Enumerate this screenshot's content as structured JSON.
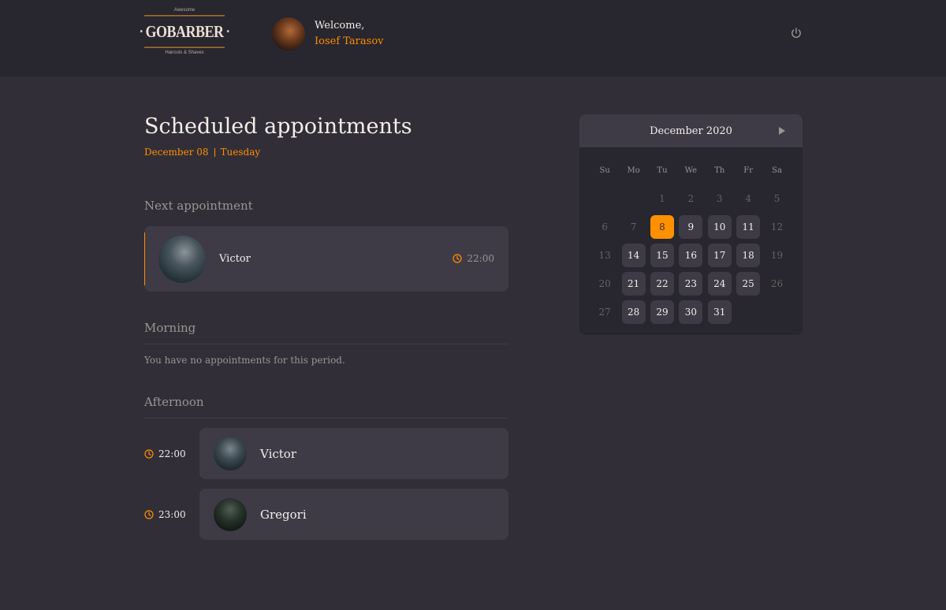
{
  "header": {
    "logo": {
      "top": "Awesome",
      "brand": "GOBARBER",
      "bottom": "Haircuts & Shaves"
    },
    "welcome": "Welcome,",
    "user_name": "Iosef Tarasov",
    "power_icon": "power-icon"
  },
  "schedule": {
    "title": "Scheduled appointments",
    "date": "December 08",
    "weekday": "Tuesday",
    "next_label": "Next appointment",
    "next": {
      "name": "Victor",
      "time": "22:00"
    },
    "morning_label": "Morning",
    "morning_empty": "You have no appointments for this period.",
    "afternoon_label": "Afternoon",
    "afternoon": [
      {
        "time": "22:00",
        "name": "Victor"
      },
      {
        "time": "23:00",
        "name": "Gregori"
      }
    ]
  },
  "calendar": {
    "month": "December 2020",
    "weekdays": [
      "Su",
      "Mo",
      "Tu",
      "We",
      "Th",
      "Fr",
      "Sa"
    ],
    "weeks": [
      [
        "",
        "",
        "1",
        "2",
        "3",
        "4",
        "5"
      ],
      [
        "6",
        "7",
        "8",
        "9",
        "10",
        "11",
        "12"
      ],
      [
        "13",
        "14",
        "15",
        "16",
        "17",
        "18",
        "19"
      ],
      [
        "20",
        "21",
        "22",
        "23",
        "24",
        "25",
        "26"
      ],
      [
        "27",
        "28",
        "29",
        "30",
        "31",
        "",
        ""
      ]
    ],
    "selected": "8",
    "accent": "#ff9000"
  }
}
